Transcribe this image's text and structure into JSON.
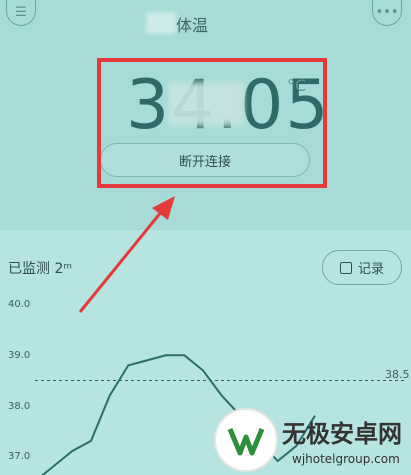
{
  "header": {
    "title": "体温"
  },
  "reading": {
    "temperature": "34.05",
    "unit": "°C",
    "disconnect_label": "断开连接"
  },
  "monitor": {
    "status_label": "已监测 2ᵐ",
    "record_label": "记录"
  },
  "chart_data": {
    "type": "line",
    "yticks": [
      "40.0",
      "39.0",
      "38.0",
      "37.0"
    ],
    "ylim": [
      37.0,
      40.0
    ],
    "threshold": {
      "value": 38.5,
      "label": "38.5"
    },
    "x": [
      0,
      1,
      2,
      3,
      4,
      5,
      6,
      7,
      8,
      9,
      10,
      11,
      12,
      13,
      14,
      15
    ],
    "values": [
      36.5,
      36.8,
      37.1,
      37.3,
      38.2,
      38.8,
      38.9,
      39.0,
      39.0,
      38.7,
      38.2,
      37.8,
      37.3,
      36.9,
      37.2,
      37.8
    ],
    "color": "#2e6d69",
    "grid": false,
    "legend": "none"
  },
  "overlay": {
    "highlight_color": "#e43a3a",
    "arrow_color": "#e43a3a"
  },
  "watermark": {
    "text": "无极安卓网",
    "url": "wjhotelgroup.com"
  }
}
